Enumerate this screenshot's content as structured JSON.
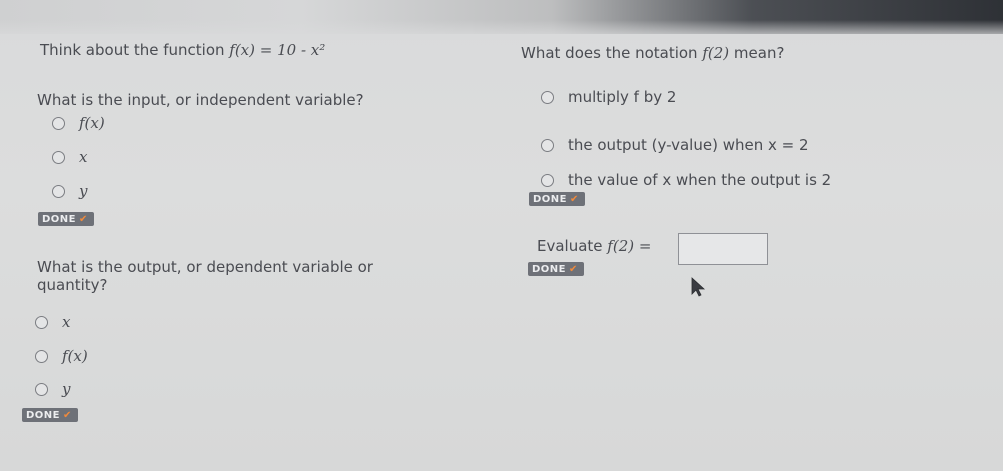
{
  "left": {
    "intro_prefix": "Think about the function ",
    "intro_func": "f(x) = 10 - x²",
    "q1": {
      "question": "What is the input, or independent variable?",
      "options": [
        "f(x)",
        "x",
        "y"
      ],
      "done_label": "DONE"
    },
    "q2": {
      "question_line1": "What is the output, or dependent variable or",
      "question_line2": "quantity?",
      "options": [
        "x",
        "f(x)",
        "y"
      ],
      "done_label": "DONE"
    }
  },
  "right": {
    "q3": {
      "question_prefix": "What does the notation ",
      "question_func": "f(2)",
      "question_suffix": " mean?",
      "options": [
        "multiply f by 2",
        "the output (y-value) when x = 2",
        "the value of x when the output is 2"
      ],
      "done_label": "DONE"
    },
    "q4": {
      "prefix": "Evaluate ",
      "func": "f(2) =",
      "answer_value": "",
      "done_label": "DONE"
    }
  },
  "colors": {
    "done_bg": "#6e7178",
    "check": "#f08a3c"
  }
}
